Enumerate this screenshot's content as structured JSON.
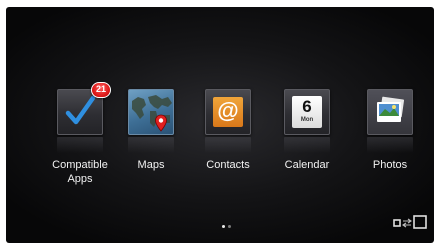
{
  "apps": [
    {
      "label": "Compatible Apps",
      "icon": "checkmark-icon",
      "badge": "21"
    },
    {
      "label": "Maps",
      "icon": "map-pin-icon"
    },
    {
      "label": "Contacts",
      "icon": "at-sign-icon",
      "glyph": "@"
    },
    {
      "label": "Calendar",
      "icon": "calendar-icon",
      "day": "6",
      "month": "Mon"
    },
    {
      "label": "Photos",
      "icon": "photos-icon"
    }
  ],
  "pager": {
    "current_page": 1,
    "page_count": 2
  },
  "colors": {
    "checkmark": "#2f8fe0",
    "badge": "#d81414",
    "contacts_accent": "#e88a24",
    "map_pin": "#e02020"
  }
}
